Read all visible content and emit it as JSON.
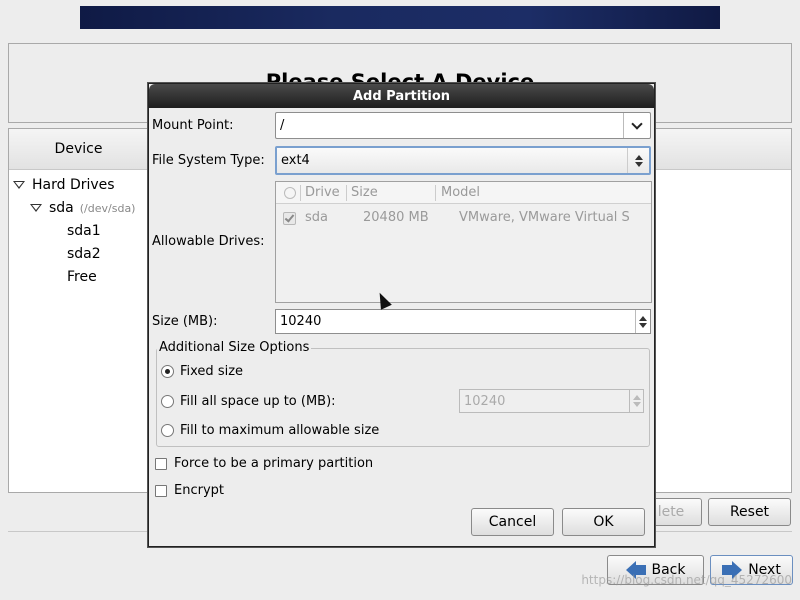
{
  "page": {
    "title": "Please Select A Device"
  },
  "device_panel": {
    "header": "Device",
    "tree": [
      {
        "label": "Hard Drives",
        "sub": ""
      },
      {
        "label": "sda",
        "sub": "(/dev/sda)"
      },
      {
        "label": "sda1",
        "sub": ""
      },
      {
        "label": "sda2",
        "sub": ""
      },
      {
        "label": "Free",
        "sub": ""
      }
    ]
  },
  "buttons": {
    "delete": "lete",
    "reset": "Reset",
    "back": "Back",
    "next": "Next"
  },
  "watermark": "https://blog.csdn.net/qq_45272600",
  "dialog": {
    "title": "Add Partition",
    "mount_point_label": "Mount Point:",
    "mount_point_value": "/",
    "fs_type_label": "File System Type:",
    "fs_type_value": "ext4",
    "allowable_drives_label": "Allowable Drives:",
    "drives_columns": [
      "Drive",
      "Size",
      "Model"
    ],
    "drives_rows": [
      {
        "drive": "sda",
        "size": "20480 MB",
        "model": "VMware, VMware Virtual S",
        "checked": true
      }
    ],
    "size_label": "Size (MB):",
    "size_value": "10240",
    "additional_options_title": "Additional Size Options",
    "opt_fixed": "Fixed size",
    "opt_fill_up_to": "Fill all space up to (MB):",
    "opt_fill_up_to_value": "10240",
    "opt_fill_max": "Fill to maximum allowable size",
    "selected_option": "fixed",
    "force_primary": "Force to be a primary partition",
    "encrypt": "Encrypt",
    "cancel": "Cancel",
    "ok": "OK"
  }
}
